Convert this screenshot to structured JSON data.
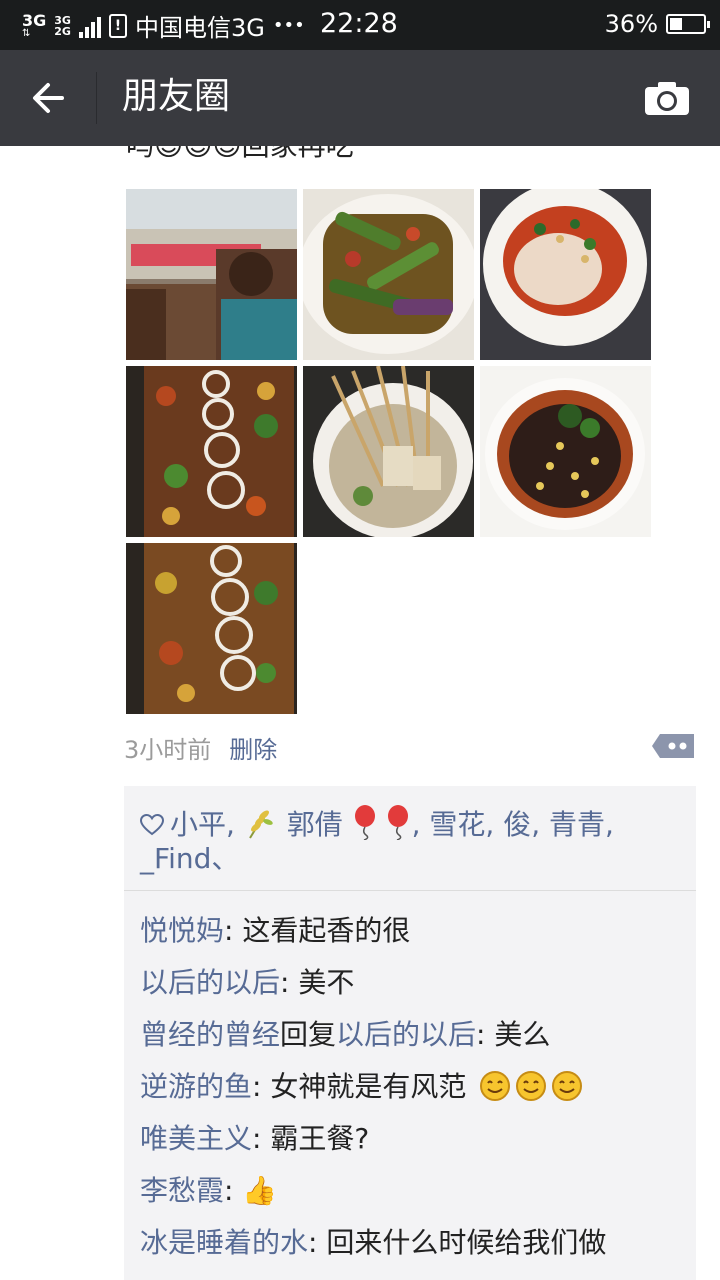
{
  "status": {
    "network_main": "3G",
    "network_sub1": "3G",
    "network_sub2": "2G",
    "sim_icon": "!",
    "carrier": "中国电信3G",
    "carrier_dots": "•••",
    "time": "22:28",
    "battery_text": "36%",
    "battery_level": 0.36
  },
  "header": {
    "back_icon": "arrow-left",
    "title": "朋友圈",
    "camera_icon": "camera"
  },
  "post": {
    "text": "吗😊😊😊回家再吃",
    "photos": [
      {
        "name": "restaurant-photo"
      },
      {
        "name": "eggplant-dish-photo"
      },
      {
        "name": "cold-noodle-dish-photo"
      },
      {
        "name": "grilled-fish-photo"
      },
      {
        "name": "skewers-pot-photo"
      },
      {
        "name": "wood-ear-salad-photo"
      },
      {
        "name": "grilled-fish-photo-2"
      }
    ],
    "time_ago": "3小时前",
    "delete_label": "删除"
  },
  "likes": {
    "heart_icon": "heart-outline",
    "part1": "小平,",
    "part2": " 郭倩 ",
    "part3": ", 雪花,  俊, 青青, _Find、"
  },
  "comments": [
    {
      "name": "悦悦妈",
      "reply_word": "",
      "reply_to": "",
      "sep": ": ",
      "text": "这看起香的很",
      "smiles": 0
    },
    {
      "name": "以后的以后",
      "reply_word": "",
      "reply_to": "",
      "sep": ": ",
      "text": "美不",
      "smiles": 0
    },
    {
      "name": "曾经的曾经",
      "reply_word": "回复",
      "reply_to": "以后的以后",
      "sep": ": ",
      "text": "美么",
      "smiles": 0
    },
    {
      "name": "逆游的鱼",
      "reply_word": "",
      "reply_to": "",
      "sep": ": ",
      "text": "女神就是有风范",
      "smiles": 3
    },
    {
      "name": "唯美主义",
      "reply_word": "",
      "reply_to": "",
      "sep": ": ",
      "text": "霸王餐?",
      "smiles": 0
    },
    {
      "name": "李愁霞",
      "reply_word": "",
      "reply_to": "",
      "sep": ": ",
      "text": "👍",
      "smiles": 0
    },
    {
      "name": "冰是睡着的水",
      "reply_word": "",
      "reply_to": "",
      "sep": ": ",
      "text": "回来什么时候给我们做",
      "smiles": 0
    }
  ],
  "colors": {
    "link": "#576b95",
    "title_bar": "#393a3f",
    "status_bar": "#1a1c1d"
  }
}
